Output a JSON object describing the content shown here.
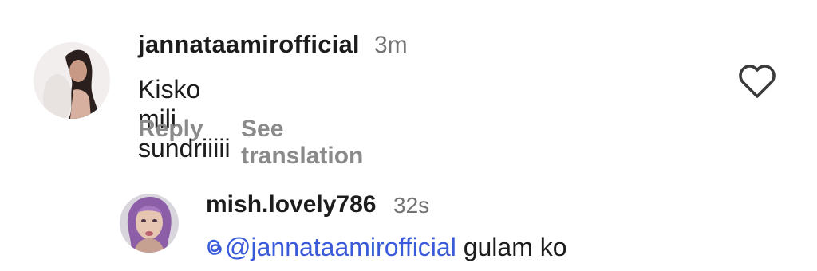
{
  "comments": [
    {
      "username": "jannataamirofficial",
      "time": "3m",
      "text": "Kisko mili sundriiiii",
      "actions": {
        "reply": "Reply",
        "translate": "See translation"
      },
      "like_icon": "heart-outline-icon"
    },
    {
      "username": "mish.lovely786",
      "time": "32s",
      "mention": "@jannataamirofficial",
      "text": "gulam ko",
      "mention_icon": "threads-icon"
    }
  ],
  "colors": {
    "username": "#1c1c1c",
    "timestamp": "#737373",
    "action": "#8a8a8a",
    "mention": "#3a5bd9"
  }
}
